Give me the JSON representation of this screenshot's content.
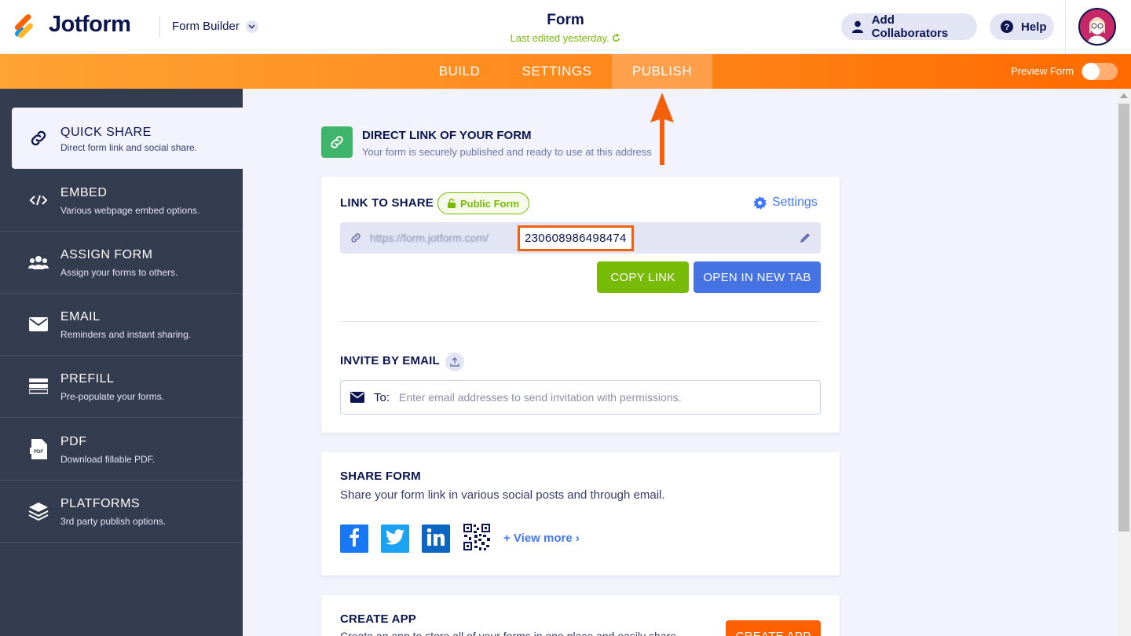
{
  "header": {
    "brand": "Jotform",
    "builder_label": "Form Builder",
    "form_title": "Form",
    "last_edited": "Last edited yesterday.",
    "add_collaborators": "Add Collaborators",
    "help": "Help"
  },
  "nav": {
    "tabs": [
      {
        "label": "BUILD"
      },
      {
        "label": "SETTINGS"
      },
      {
        "label": "PUBLISH",
        "active": true
      }
    ],
    "preview_label": "Preview Form",
    "preview_on": false
  },
  "sidebar": {
    "items": [
      {
        "title": "QUICK SHARE",
        "subtitle": "Direct form link and social share.",
        "icon": "link-icon",
        "active": true
      },
      {
        "title": "EMBED",
        "subtitle": "Various webpage embed options.",
        "icon": "code-icon"
      },
      {
        "title": "ASSIGN FORM",
        "subtitle": "Assign your forms to others.",
        "icon": "users-icon"
      },
      {
        "title": "EMAIL",
        "subtitle": "Reminders and instant sharing.",
        "icon": "envelope-icon"
      },
      {
        "title": "PREFILL",
        "subtitle": "Pre-populate your forms.",
        "icon": "prefill-icon"
      },
      {
        "title": "PDF",
        "subtitle": "Download fillable PDF.",
        "icon": "pdf-icon"
      },
      {
        "title": "PLATFORMS",
        "subtitle": "3rd party publish options.",
        "icon": "layers-icon"
      }
    ]
  },
  "direct_link": {
    "title": "DIRECT LINK OF YOUR FORM",
    "subtitle": "Your form is securely published and ready to use at this address"
  },
  "link_card": {
    "label": "LINK TO SHARE",
    "badge": "Public Form",
    "settings": "Settings",
    "url_prefix": "https://form.jotform.com/",
    "form_id": "230608986498474",
    "copy_button": "COPY LINK",
    "open_button": "OPEN IN NEW TAB",
    "invite_label": "INVITE BY EMAIL",
    "to_label": "To:",
    "email_placeholder": "Enter email addresses to send invitation with permissions."
  },
  "share_card": {
    "title": "SHARE FORM",
    "subtitle": "Share your form link in various social posts and through email.",
    "view_more": "+ View more ›"
  },
  "app_card": {
    "title": "CREATE APP",
    "subtitle": "Create an app to store all of your forms in one place and easily share",
    "button": "CREATE APP"
  },
  "colors": {
    "accent_orange": "#ff6100",
    "sidebar_bg": "#343c4f",
    "copy_green": "#78bb07",
    "open_blue": "#4573e3",
    "highlight": "#f2600c"
  }
}
